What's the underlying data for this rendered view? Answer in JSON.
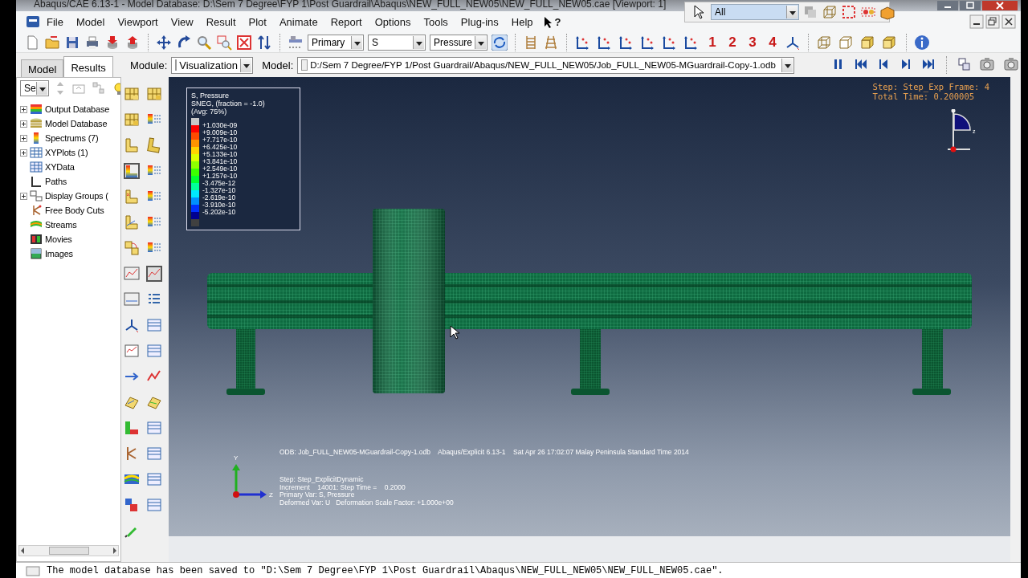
{
  "window": {
    "title": "Abaqus/CAE 6.13-1 - Model Database: D:\\Sem 7 Degree\\FYP 1\\Post Guardrail\\Abaqus\\NEW_FULL_NEW05\\NEW_FULL_NEW05.cae [Viewport: 1]"
  },
  "selection_toolbar": {
    "filter": "All"
  },
  "menu": [
    "File",
    "Model",
    "Viewport",
    "View",
    "Result",
    "Plot",
    "Animate",
    "Report",
    "Options",
    "Tools",
    "Plug-ins",
    "Help"
  ],
  "context_help": "?",
  "toolbar": {
    "combos": [
      "Primary",
      "S",
      "Pressure"
    ],
    "views": [
      "1",
      "2",
      "3",
      "4"
    ]
  },
  "tabs": [
    {
      "label": "Model",
      "selected": false
    },
    {
      "label": "Results",
      "selected": true
    }
  ],
  "module": {
    "label": "Module:",
    "value": "Visualization"
  },
  "model": {
    "label": "Model:",
    "value": "D:/Sem 7 Degree/FYP 1/Post Guardrail/Abaqus/NEW_FULL_NEW05/Job_FULL_NEW05-MGuardrail-Copy-1.odb"
  },
  "tree": {
    "filter": "Se",
    "items": [
      {
        "label": "Output Database",
        "kind": "group",
        "expanded": false
      },
      {
        "label": "Model Database",
        "kind": "group",
        "expanded": false
      },
      {
        "label": "Spectrums (7)",
        "kind": "group",
        "expanded": false
      },
      {
        "label": "XYPlots (1)",
        "kind": "group",
        "expanded": false
      },
      {
        "label": "XYData",
        "kind": "leaf"
      },
      {
        "label": "Paths",
        "kind": "leaf"
      },
      {
        "label": "Display Groups (",
        "kind": "group",
        "expanded": false
      },
      {
        "label": "Free Body Cuts",
        "kind": "leaf"
      },
      {
        "label": "Streams",
        "kind": "leaf"
      },
      {
        "label": "Movies",
        "kind": "leaf"
      },
      {
        "label": "Images",
        "kind": "leaf"
      }
    ]
  },
  "viewport": {
    "legend": {
      "title": [
        "S, Pressure",
        "SNEG, (fraction = -1.0)",
        "(Avg: 75%)"
      ],
      "values": [
        "+1.030e-09",
        "+9.009e-10",
        "+7.717e-10",
        "+6.425e-10",
        "+5.133e-10",
        "+3.841e-10",
        "+2.549e-10",
        "+1.257e-10",
        "-3.475e-12",
        "-1.327e-10",
        "-2.619e-10",
        "-3.910e-10",
        "-5.202e-10"
      ],
      "swatches": [
        {
          "color": "#c8c8c8"
        },
        {
          "color": "#ff0000"
        },
        {
          "color": "#ff4a00"
        },
        {
          "color": "#ff9400"
        },
        {
          "color": "#ffd400"
        },
        {
          "color": "#dcff00"
        },
        {
          "color": "#8eff00"
        },
        {
          "color": "#3cff00"
        },
        {
          "color": "#00ff30"
        },
        {
          "color": "#00ff9a"
        },
        {
          "color": "#00e8ff"
        },
        {
          "color": "#0090ff"
        },
        {
          "color": "#0030ff"
        },
        {
          "color": "#000090"
        },
        {
          "color": "#404040"
        }
      ]
    },
    "step_info": [
      "Step: Step_Exp Frame: 4",
      "Total Time: 0.200005"
    ],
    "orientation_label": "z",
    "odb_line": "ODB: Job_FULL_NEW05-MGuardrail-Copy-1.odb    Abaqus/Explicit 6.13-1    Sat Apr 26 17:02:07 Malay Peninsula Standard Time 2014",
    "state_lines": [
      "Step: Step_ExplicitDynamic",
      "Increment    14001: Step Time =    0.2000",
      "Primary Var: S, Pressure",
      "Deformed Var: U   Deformation Scale Factor: +1.000e+00"
    ],
    "triad": {
      "y": "Y",
      "z": "Z"
    }
  },
  "message": "The model database has been saved to \"D:\\Sem 7 Degree\\FYP 1\\Post Guardrail\\Abaqus\\NEW_FULL_NEW05\\NEW_FULL_NEW05.cae\"."
}
